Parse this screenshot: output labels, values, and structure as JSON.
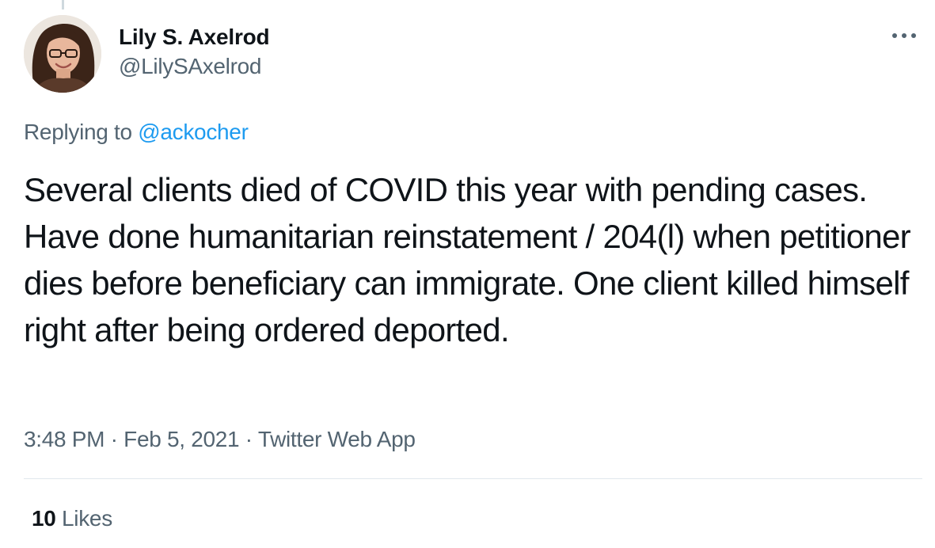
{
  "author": {
    "display_name": "Lily S. Axelrod",
    "handle": "@LilySAxelrod"
  },
  "reply": {
    "prefix": "Replying to ",
    "mention": "@ackocher"
  },
  "tweet": {
    "text": "Several clients died of COVID this year with pending cases. Have done humanitarian reinstatement / 204(l) when petitioner dies before beneficiary can immigrate. One client killed himself right after being ordered deported."
  },
  "meta": {
    "time": "3:48 PM",
    "separator": " · ",
    "date": "Feb 5, 2021",
    "source": "Twitter Web App"
  },
  "stats": {
    "likes_count": "10",
    "likes_label": " Likes"
  },
  "icons": {
    "more": "more-horizontal-icon",
    "avatar": "profile-photo"
  },
  "colors": {
    "text": "#0f1419",
    "secondary": "#536471",
    "link": "#1d9bf0",
    "divider": "#e1e8ed"
  }
}
